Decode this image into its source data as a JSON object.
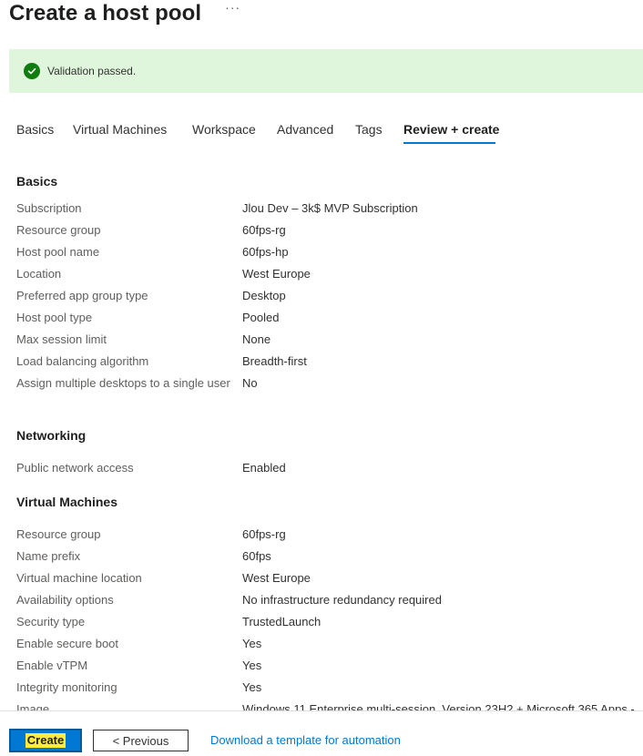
{
  "page": {
    "title": "Create a host pool",
    "more": "···"
  },
  "validation": {
    "message": "Validation passed."
  },
  "tabs": [
    {
      "label": "Basics",
      "active": false
    },
    {
      "label": "Virtual Machines",
      "active": false
    },
    {
      "label": "Workspace",
      "active": false
    },
    {
      "label": "Advanced",
      "active": false
    },
    {
      "label": "Tags",
      "active": false
    },
    {
      "label": "Review + create",
      "active": true
    }
  ],
  "basics": {
    "title": "Basics",
    "rows": [
      {
        "key": "Subscription",
        "value": "Jlou Dev – 3k$ MVP Subscription"
      },
      {
        "key": "Resource group",
        "value": "60fps-rg"
      },
      {
        "key": "Host pool name",
        "value": "60fps-hp"
      },
      {
        "key": "Location",
        "value": "West Europe"
      },
      {
        "key": "Preferred app group type",
        "value": "Desktop"
      },
      {
        "key": "Host pool type",
        "value": "Pooled"
      },
      {
        "key": "Max session limit",
        "value": "None"
      },
      {
        "key": "Load balancing algorithm",
        "value": "Breadth-first"
      },
      {
        "key": "Assign multiple desktops to a single user",
        "value": "No"
      }
    ]
  },
  "networking": {
    "title": "Networking",
    "rows": [
      {
        "key": "Public network access",
        "value": "Enabled"
      }
    ]
  },
  "virtual_machines": {
    "title": "Virtual Machines",
    "rows": [
      {
        "key": "Resource group",
        "value": "60fps-rg"
      },
      {
        "key": "Name prefix",
        "value": "60fps"
      },
      {
        "key": "Virtual machine location",
        "value": "West Europe"
      },
      {
        "key": "Availability options",
        "value": "No infrastructure redundancy required"
      },
      {
        "key": "Security type",
        "value": "TrustedLaunch"
      },
      {
        "key": "Enable secure boot",
        "value": "Yes"
      },
      {
        "key": "Enable vTPM",
        "value": "Yes"
      },
      {
        "key": "Integrity monitoring",
        "value": "Yes"
      },
      {
        "key": "Image",
        "value": "Windows 11 Enterprise multi-session, Version 23H2 + Microsoft 365 Apps -"
      }
    ]
  },
  "footer": {
    "create_label": "Create",
    "previous_label": "< Previous",
    "download_label": "Download a template for automation"
  },
  "colors": {
    "accent": "#0078d4",
    "success_bg": "#dff6dd",
    "success_icon": "#107c10",
    "highlight": "#ffeb3b"
  }
}
